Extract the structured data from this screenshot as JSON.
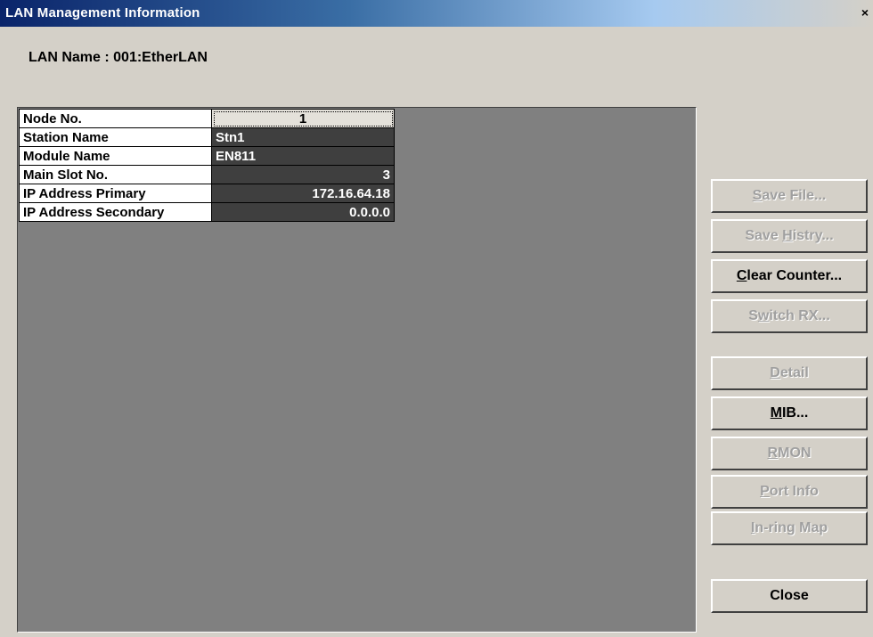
{
  "window": {
    "title": "LAN Management Information",
    "close_glyph": "×"
  },
  "lan": {
    "label": "LAN Name :",
    "value": "001:EtherLAN"
  },
  "table": {
    "rows": [
      {
        "label": "Node No.",
        "value": "1"
      },
      {
        "label": "Station Name",
        "value": "Stn1"
      },
      {
        "label": "Module Name",
        "value": "EN811"
      },
      {
        "label": "Main Slot No.",
        "value": "3"
      },
      {
        "label": "IP Address Primary",
        "value": "172.16.64.18"
      },
      {
        "label": "IP Address Secondary",
        "value": "0.0.0.0"
      }
    ]
  },
  "buttons": {
    "save_file": {
      "mnemonic": "S",
      "rest": "ave File...",
      "enabled": false
    },
    "save_history": {
      "pre": "Save ",
      "mnemonic": "H",
      "rest": "istry...",
      "enabled": false
    },
    "clear_counter": {
      "mnemonic": "C",
      "rest": "lear Counter...",
      "enabled": true
    },
    "switch_rx": {
      "pre": "S",
      "mnemonic": "w",
      "rest": "itch RX...",
      "enabled": false
    },
    "detail": {
      "mnemonic": "D",
      "rest": "etail",
      "enabled": false
    },
    "mib": {
      "mnemonic": "M",
      "rest": "IB...",
      "enabled": true
    },
    "rmon": {
      "mnemonic": "R",
      "rest": "MON",
      "enabled": false
    },
    "port_info": {
      "mnemonic": "P",
      "rest": "ort Info",
      "enabled": false
    },
    "in_ring_map": {
      "mnemonic": "I",
      "rest": "n-ring Map",
      "enabled": false
    },
    "close": {
      "label": "Close",
      "enabled": true
    }
  },
  "colors": {
    "title_bar_start": "#0a246a",
    "dialog_background": "#d4d0c8",
    "grid_background": "#808080",
    "value_cell_background": "#3f3f3f"
  }
}
